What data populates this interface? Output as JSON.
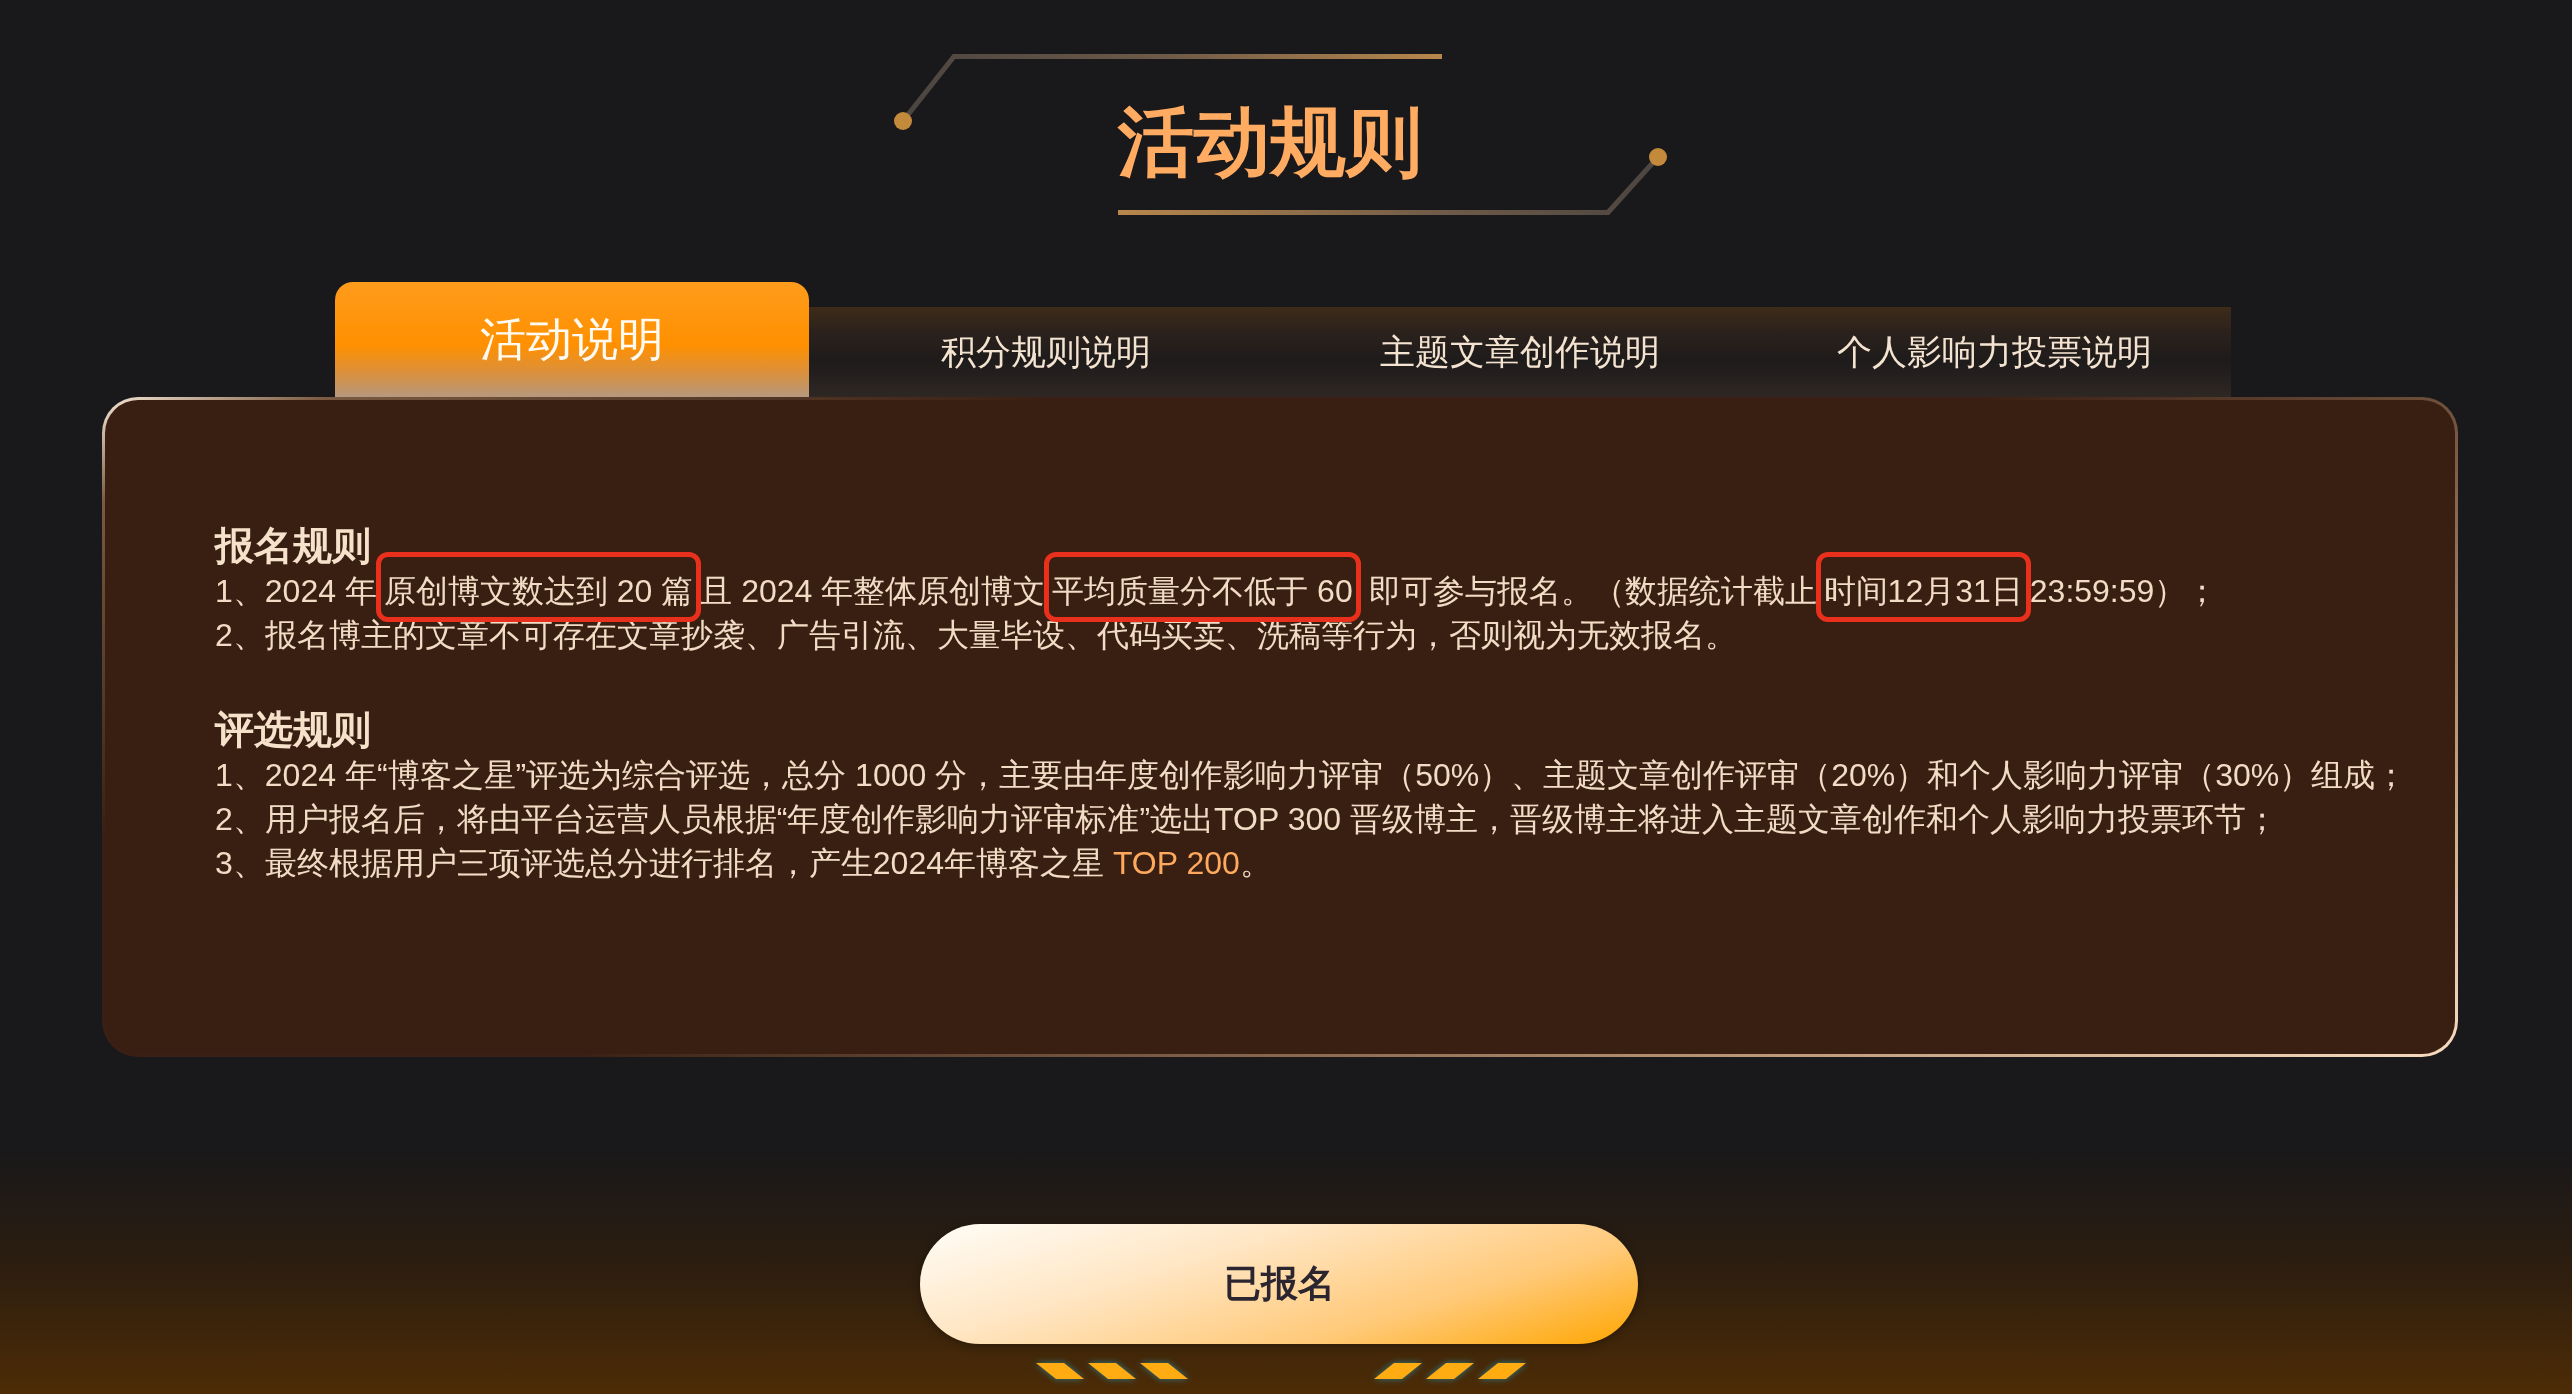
{
  "title": "活动规则",
  "tabs": [
    {
      "label": "活动说明",
      "selected": true
    },
    {
      "label": "积分规则说明",
      "selected": false
    },
    {
      "label": "主题文章创作说明",
      "selected": false
    },
    {
      "label": "个人影响力投票说明",
      "selected": false
    }
  ],
  "sections": [
    {
      "heading": "报名规则",
      "lines": [
        {
          "segments": [
            {
              "text": "1、2024 年",
              "boxed": false,
              "accent": false
            },
            {
              "text": "原创博文数达到 20 篇",
              "boxed": true,
              "accent": false
            },
            {
              "text": "且 2024 年整体原创博文",
              "boxed": false,
              "accent": false
            },
            {
              "text": "平均质量分不低于 60",
              "boxed": true,
              "accent": false
            },
            {
              "text": " 即可参与报名。（数据统计截止",
              "boxed": false,
              "accent": false
            },
            {
              "text": "时间12月31日",
              "boxed": true,
              "accent": false
            },
            {
              "text": "23:59:59）；",
              "boxed": false,
              "accent": false
            }
          ]
        },
        "2、报名博主的文章不可存在文章抄袭、广告引流、大量毕设、代码买卖、洗稿等行为，否则视为无效报名。"
      ]
    },
    {
      "heading": "评选规则",
      "lines": [
        "1、2024 年“博客之星”评选为综合评选，总分 1000 分，主要由年度创作影响力评审（50%）、主题文章创作评审（20%）和个人影响力评审（30%）组成；",
        "2、用户报名后，将由平台运营人员根据“年度创作影响力评审标准”选出TOP 300 晋级博主，晋级博主将进入主题文章创作和个人影响力投票环节；",
        {
          "segments": [
            {
              "text": "3、最终根据用户三项评选总分进行排名，产生2024年博客之星 ",
              "boxed": false,
              "accent": false
            },
            {
              "text": "TOP 200",
              "boxed": false,
              "accent": true
            },
            {
              "text": "。",
              "boxed": false,
              "accent": false
            }
          ]
        }
      ]
    }
  ],
  "button": {
    "label": "已报名"
  }
}
